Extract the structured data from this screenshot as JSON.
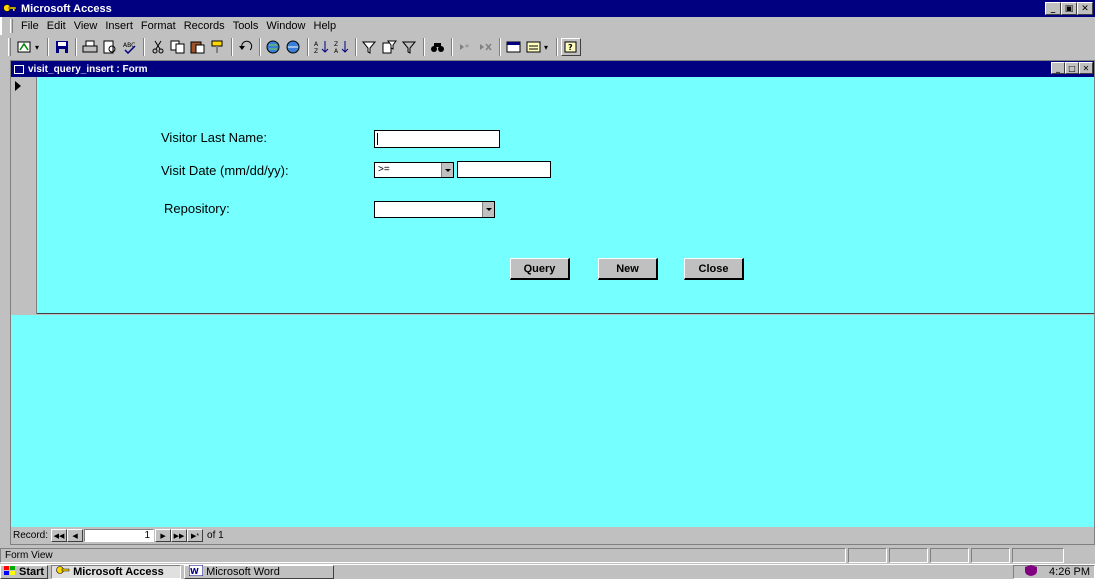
{
  "app": {
    "title": "Microsoft Access",
    "controls": {
      "minimize": "_",
      "restore": "▣",
      "close": "✕"
    }
  },
  "menu": [
    "File",
    "Edit",
    "View",
    "Insert",
    "Format",
    "Records",
    "Tools",
    "Window",
    "Help"
  ],
  "toolbar": {
    "icons": [
      "view-icon",
      "save-icon",
      "print-icon",
      "print-preview-icon",
      "spelling-icon",
      "cut-icon",
      "copy-icon",
      "paste-icon",
      "format-painter-icon",
      "undo-icon",
      "insert-hyperlink-icon",
      "web-toolbar-icon",
      "sort-ascending-icon",
      "sort-descending-icon",
      "filter-by-selection-icon",
      "filter-by-form-icon",
      "apply-filter-icon",
      "find-icon",
      "new-record-icon",
      "delete-record-icon",
      "database-window-icon",
      "new-object-icon",
      "help-icon"
    ]
  },
  "form": {
    "title": "visit_query_insert : Form",
    "visitor_last_name_label": "Visitor Last Name:",
    "visitor_last_name_value": "",
    "visit_date_label": "Visit Date (mm/dd/yy):",
    "date_operator_value": ">=",
    "visit_date_value": "",
    "repository_label": "Repository:",
    "repository_value": "",
    "query_button": "Query",
    "new_button": "New",
    "close_button": "Close",
    "background_color": "#75ffff"
  },
  "navigation": {
    "record_label": "Record:",
    "current_record": "1",
    "of_text": "of 1"
  },
  "status": {
    "text": "Form View"
  },
  "taskbar": {
    "start_label": "Start",
    "tasks": [
      {
        "label": "Microsoft Access",
        "active": true
      },
      {
        "label": "Microsoft Word",
        "active": false
      }
    ],
    "clock": "4:26 PM"
  }
}
